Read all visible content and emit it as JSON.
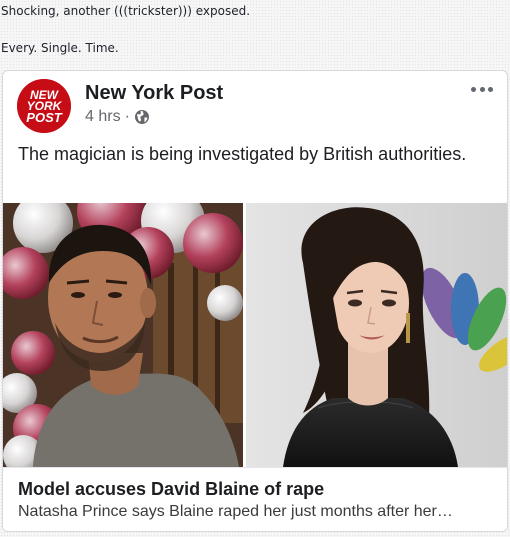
{
  "comment": {
    "line1": "Shocking, another (((trickster))) exposed.",
    "line2": "Every. Single. Time."
  },
  "post": {
    "page_name": "New York Post",
    "timestamp": "4 hrs",
    "separator": "·",
    "privacy_icon": "globe-icon",
    "more_icon": "more-options-icon",
    "text": "The magician is being investigated by British authorities.",
    "logo": {
      "line1": "NEW",
      "line2": "YORK",
      "line3": "POST",
      "color": "#c60d16"
    }
  },
  "link": {
    "title": "Model accuses David Blaine of rape",
    "description": "Natasha Prince says Blaine raped her just months after her…"
  }
}
